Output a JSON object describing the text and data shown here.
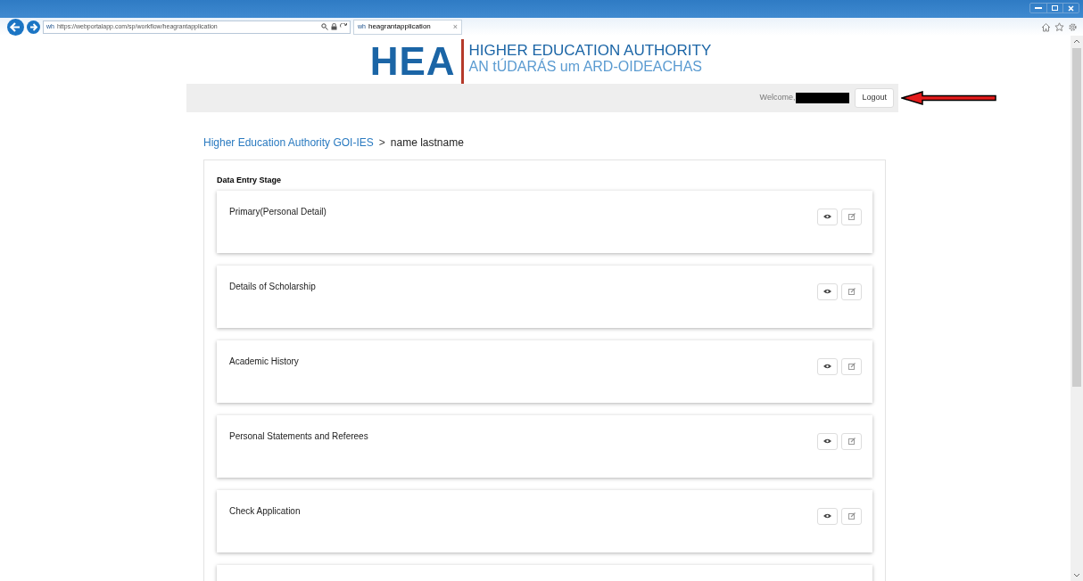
{
  "browser": {
    "address_badge": "wh",
    "address": "https://webportalapp.com/sp/workflow/heagrantapplication",
    "tab": {
      "badge": "wh",
      "title": "heagrantapplication",
      "close": "×"
    }
  },
  "logo": {
    "mark": "HEA",
    "name": "HIGHER EDUCATION AUTHORITY",
    "irish_name": "AN tÚDARÁS um ARD-OIDEACHAS"
  },
  "header": {
    "welcome": "Welcome,",
    "logout": "Logout"
  },
  "breadcrumb": [
    {
      "label": "Higher Education Authority GOI-IES",
      "kind": "link"
    },
    {
      "label": ">",
      "kind": "separator"
    },
    {
      "label": "name lastname",
      "kind": "current"
    }
  ],
  "panel": {
    "title": "Data Entry Stage",
    "stages": [
      {
        "title": "Primary(Personal Detail)"
      },
      {
        "title": "Details of Scholarship"
      },
      {
        "title": "Academic History"
      },
      {
        "title": "Personal Statements and Referees"
      },
      {
        "title": "Check Application"
      }
    ]
  }
}
